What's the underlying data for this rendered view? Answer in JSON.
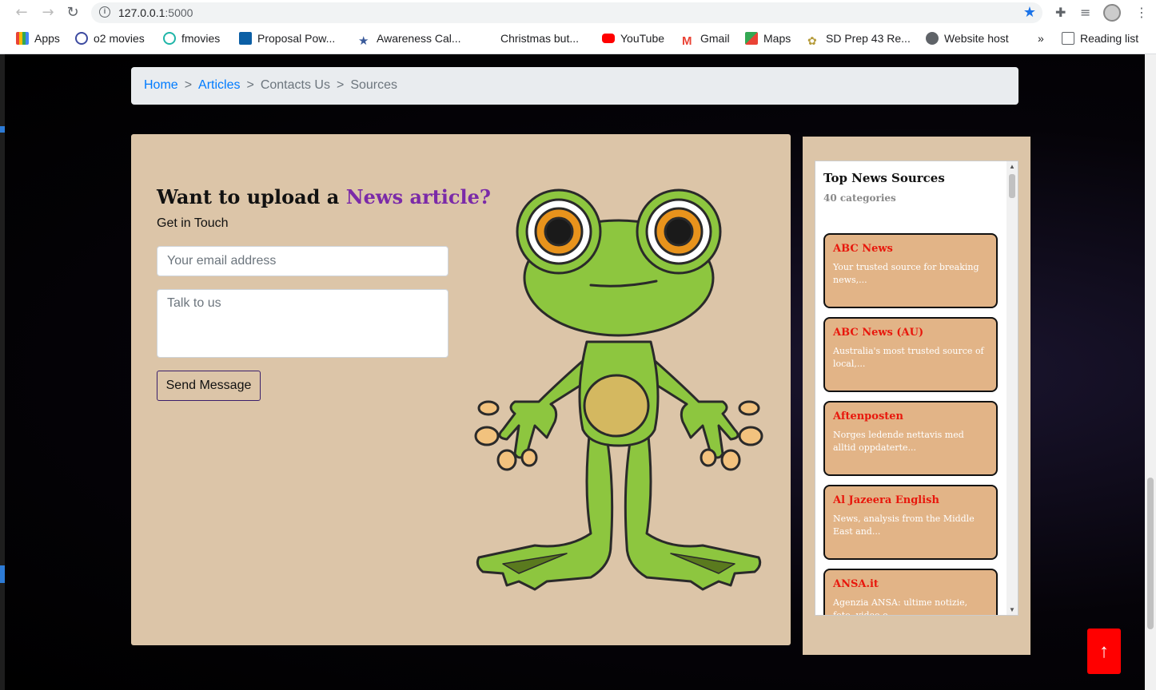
{
  "browser": {
    "url_host": "127.0.0.1",
    "url_port": ":5000",
    "bookmarks": [
      "Apps",
      "o2 movies",
      "fmovies",
      "Proposal Pow...",
      "Awareness Cal...",
      "Christmas but...",
      "YouTube",
      "Gmail",
      "Maps",
      "SD Prep 43 Re...",
      "Website host"
    ],
    "overflow": "»",
    "reading_list": "Reading list"
  },
  "breadcrumb": {
    "home": "Home",
    "articles": "Articles",
    "contacts": "Contacts Us",
    "sources": "Sources",
    "sep": ">"
  },
  "contact": {
    "heading_pre": "Want to upload a ",
    "heading_accent": "News article?",
    "subheading": "Get in Touch",
    "email_placeholder": "Your email address",
    "message_placeholder": "Talk to us",
    "send_label": "Send Message"
  },
  "sources": {
    "title": "Top News Sources",
    "count": "40 categories",
    "items": [
      {
        "name": "ABC News",
        "desc": "Your trusted source for breaking news,..."
      },
      {
        "name": "ABC News (AU)",
        "desc": "Australia's most trusted source of local,..."
      },
      {
        "name": "Aftenposten",
        "desc": "Norges ledende nettavis med alltid oppdaterte..."
      },
      {
        "name": "Al Jazeera English",
        "desc": "News, analysis from the Middle East and..."
      },
      {
        "name": "ANSA.it",
        "desc": "Agenzia ANSA: ultime notizie, foto, video e..."
      }
    ]
  },
  "back_to_top": "↑"
}
